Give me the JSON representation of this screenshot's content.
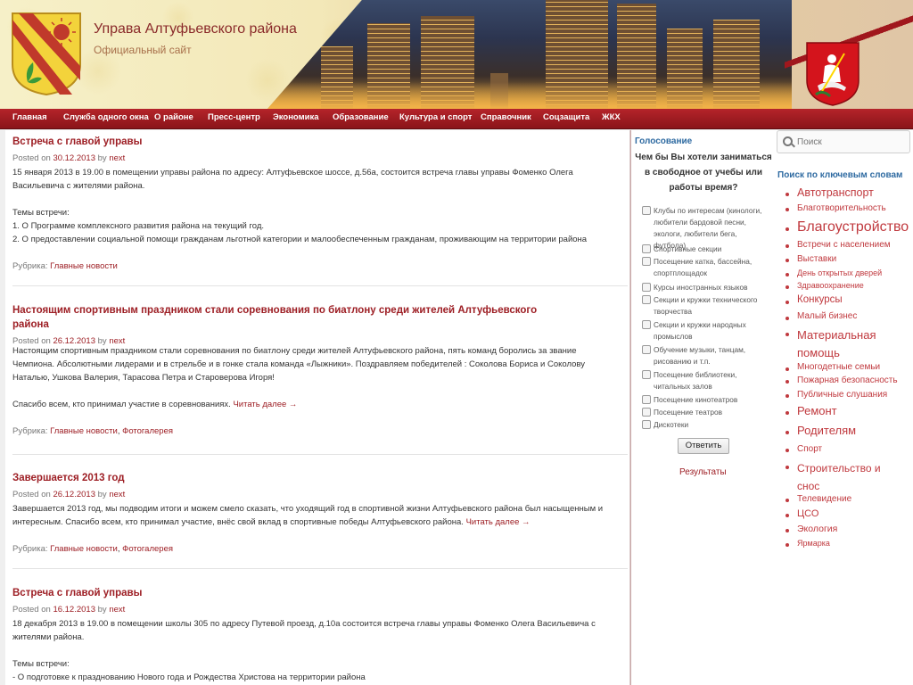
{
  "header": {
    "title": "Управа Алтуфьевского района",
    "subtitle": "Официальный сайт"
  },
  "nav": [
    "Главная",
    "Служба одного окна",
    "О районе",
    "Пресс-центр",
    "Экономика",
    "Образование",
    "Культура и спорт",
    "Справочник",
    "Соцзащита",
    "ЖКХ"
  ],
  "posts": [
    {
      "title": "Встреча с главой управы",
      "posted_on": "Posted on",
      "date": "30.12.2013",
      "by": "by",
      "author": "next",
      "body": [
        "15 января 2013 в 19.00 в помещении управы района по адресу: Алтуфьевское шоссе, д.56а, состоится встреча главы управы Фоменко Олега Васильевича с жителями района.",
        "Темы встречи:",
        "1. О Программе комплексного развития района на текущий год.",
        "2. О предоставлении социальной помощи гражданам льготной категории и малообеспеченным гражданам, проживающим на территории района"
      ],
      "rubric_label": "Рубрика:",
      "rubrics": [
        "Главные новости"
      ]
    },
    {
      "title": "Настоящим спортивным праздником стали соревнования по биатлону среди жителей Алтуфьевского района",
      "posted_on": "Posted on",
      "date": "26.12.2013",
      "by": "by",
      "author": "next",
      "body": [
        "Настоящим спортивным праздником стали соревнования по биатлону среди жителей Алтуфьевского района, пять команд боролись за звание Чемпиона. Абсолютными лидерами и в стрельбе и в гонке стала команда «Лыжники». Поздравляем победителей : Соколова Бориса и Соколову Наталью, Ушкова Валерия, Тарасова Петра и Староверова Игоря!",
        "Спасибо всем, кто принимал участие в соревнованиях."
      ],
      "more": "Читать далее →",
      "rubric_label": "Рубрика:",
      "rubrics": [
        "Главные новости",
        "Фотогалерея"
      ]
    },
    {
      "title": "Завершается 2013 год",
      "posted_on": "Posted on",
      "date": "26.12.2013",
      "by": "by",
      "author": "next",
      "body": [
        "Завершается 2013 год, мы подводим итоги и можем смело сказать, что уходящий год в спортивной жизни Алтуфьевского района был насыщенным и интересным. Спасибо всем, кто принимал участие, внёс свой вклад в спортивные победы Алтуфьевского района."
      ],
      "more": "Читать далее →",
      "rubric_label": "Рубрика:",
      "rubrics": [
        "Главные новости",
        "Фотогалерея"
      ]
    },
    {
      "title": "Встреча с главой управы",
      "posted_on": "Posted on",
      "date": "16.12.2013",
      "by": "by",
      "author": "next",
      "body": [
        "18 декабря 2013 в 19.00 в помещении школы 305 по адресу Путевой проезд, д.10а состоится встреча главы управы Фоменко Олега Васильевича с жителями района.",
        "Темы встречи:",
        "- О подготовке к празднованию Нового года и Рождества Христова на территории района"
      ]
    }
  ],
  "poll": {
    "title": "Голосование",
    "question": "Чем бы Вы хотели заниматься в свободное от учебы или работы время?",
    "options": [
      "Клубы по интересам (кинологи, любители бардовой песни, экологи, любители бега, футбола)",
      "Спортивные секции",
      "Посещение катка, бассейна, спортплощадок",
      "Курсы иностранных языков",
      "Секции и кружки технического творчества",
      "Секции и кружки народных промыслов",
      "Обучение музыки, танцам, рисованию и т.п.",
      "Посещение библиотеки, читальных залов",
      "Посещение кинотеатров",
      "Посещение театров",
      "Дискотеки"
    ],
    "vote": "Ответить",
    "results": "Результаты"
  },
  "sidebar": {
    "search_placeholder": "Поиск",
    "tags_title": "Поиск по ключевым словам",
    "tags": [
      "Автотранспорт",
      "Благотворительность",
      "Благоустройство",
      "Встречи с населением",
      "Выставки",
      "День открытых дверей",
      "Здравоохранение",
      "Конкурсы",
      "Малый бизнес",
      "Материальная помощь",
      "Многодетные семьи",
      "Пожарная безопасность",
      "Публичные слушания",
      "Ремонт",
      "Родителям",
      "Спорт",
      "Строительство и снос",
      "Телевидение",
      "ЦСО",
      "Экология",
      "Ярмарка"
    ]
  },
  "colors": {
    "accent": "#9d1e24",
    "nav": "#a0171d",
    "link_blue": "#2e6aa1"
  }
}
